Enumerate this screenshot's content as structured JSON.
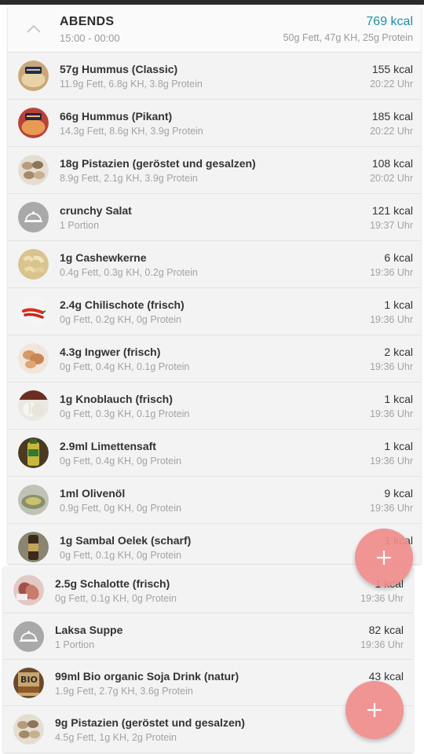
{
  "meal": {
    "title": "ABENDS",
    "time_range": "15:00 - 00:00",
    "total_kcal": "769 kcal",
    "macros": "50g Fett, 47g KH, 25g Protein"
  },
  "items": [
    {
      "name": "57g Hummus (Classic)",
      "detail": "11.9g Fett, 6.8g KH, 3.8g Protein",
      "kcal": "155 kcal",
      "time": "20:22 Uhr",
      "icon": "hummus-classic-icon"
    },
    {
      "name": "66g Hummus (Pikant)",
      "detail": "14.3g Fett, 8.6g KH, 3.9g Protein",
      "kcal": "185 kcal",
      "time": "20:22 Uhr",
      "icon": "hummus-pikant-icon"
    },
    {
      "name": "18g Pistazien (geröstet und gesalzen)",
      "detail": "8.9g Fett, 2.1g KH, 3.9g Protein",
      "kcal": "108 kcal",
      "time": "20:02 Uhr",
      "icon": "pistachio-icon"
    },
    {
      "name": "crunchy Salat",
      "detail": "1 Portion",
      "kcal": "121 kcal",
      "time": "19:37 Uhr",
      "icon": "cloche-icon"
    },
    {
      "name": "1g Cashewkerne",
      "detail": "0.4g Fett, 0.3g KH, 0.2g Protein",
      "kcal": "6 kcal",
      "time": "19:36 Uhr",
      "icon": "cashew-icon"
    },
    {
      "name": "2.4g Chilischote (frisch)",
      "detail": "0g Fett, 0.2g KH, 0g Protein",
      "kcal": "1 kcal",
      "time": "19:36 Uhr",
      "icon": "chili-icon"
    },
    {
      "name": "4.3g Ingwer (frisch)",
      "detail": "0g Fett, 0.4g KH, 0.1g Protein",
      "kcal": "2 kcal",
      "time": "19:36 Uhr",
      "icon": "ginger-icon"
    },
    {
      "name": "1g Knoblauch (frisch)",
      "detail": "0g Fett, 0.3g KH, 0.1g Protein",
      "kcal": "1 kcal",
      "time": "19:36 Uhr",
      "icon": "garlic-icon"
    },
    {
      "name": "2.9ml Limettensaft",
      "detail": "0g Fett, 0.4g KH, 0g Protein",
      "kcal": "1 kcal",
      "time": "19:36 Uhr",
      "icon": "lime-juice-icon"
    },
    {
      "name": "1ml Olivenöl",
      "detail": "0.9g Fett, 0g KH, 0g Protein",
      "kcal": "9 kcal",
      "time": "19:36 Uhr",
      "icon": "olive-oil-icon"
    },
    {
      "name": "1g Sambal Oelek (scharf)",
      "detail": "0g Fett, 0.1g KH, 0g Protein",
      "kcal": "1 kcal",
      "time": "",
      "icon": "sambal-jar-icon"
    }
  ],
  "items2": [
    {
      "name": "2.5g Schalotte (frisch)",
      "detail": "0g Fett, 0.1g KH, 0g Protein",
      "kcal": "1 kcal",
      "time": "19:36 Uhr",
      "icon": "shallot-icon"
    },
    {
      "name": "Laksa Suppe",
      "detail": "1 Portion",
      "kcal": "82 kcal",
      "time": "19:36 Uhr",
      "icon": "cloche-icon"
    },
    {
      "name": "99ml Bio organic Soja Drink (natur)",
      "detail": "1.9g Fett, 2.7g KH, 3.6g Protein",
      "kcal": "43 kcal",
      "time": "",
      "icon": "soy-drink-icon"
    },
    {
      "name": "9g Pistazien (geröstet und gesalzen)",
      "detail": "4.5g Fett, 1g KH, 2g Protein",
      "kcal": "",
      "time": "",
      "icon": "pistachio-icon"
    }
  ],
  "colors": {
    "accent": "#1f8fa6",
    "fab": "#f08c8c"
  }
}
